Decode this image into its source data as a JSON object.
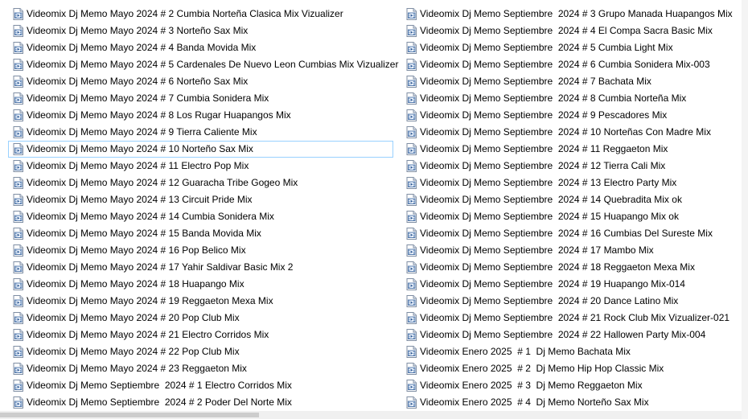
{
  "file_icon": "video-file-icon",
  "colors": {
    "focus_border": "#99d1ff",
    "icon_frame": "#5a7fb0",
    "icon_fill": "#e8f0fb"
  },
  "left_column": [
    "Videomix Dj Memo Mayo 2024 # 2 Cumbia Norteña Clasica Mix Vizualizer",
    "Videomix Dj Memo Mayo 2024 # 3 Norteño Sax Mix",
    "Videomix Dj Memo Mayo 2024 # 4 Banda Movida Mix",
    "Videomix Dj Memo Mayo 2024 # 5 Cardenales De Nuevo Leon Cumbias Mix Vizualizer",
    "Videomix Dj Memo Mayo 2024 # 6 Norteño Sax Mix",
    "Videomix Dj Memo Mayo 2024 # 7 Cumbia Sonidera Mix",
    "Videomix Dj Memo Mayo 2024 # 8 Los Rugar Huapangos Mix",
    "Videomix Dj Memo Mayo 2024 # 9 Tierra Caliente Mix",
    "Videomix Dj Memo Mayo 2024 # 10 Norteño Sax Mix",
    "Videomix Dj Memo Mayo 2024 # 11 Electro Pop Mix",
    "Videomix Dj Memo Mayo 2024 # 12 Guaracha Tribe Gogeo Mix",
    "Videomix Dj Memo Mayo 2024 # 13 Circuit Pride Mix",
    "Videomix Dj Memo Mayo 2024 # 14 Cumbia Sonidera Mix",
    "Videomix Dj Memo Mayo 2024 # 15 Banda Movida Mix",
    "Videomix Dj Memo Mayo 2024 # 16 Pop Belico Mix",
    "Videomix Dj Memo Mayo 2024 # 17 Yahir Saldivar Basic Mix 2",
    "Videomix Dj Memo Mayo 2024 # 18 Huapango Mix",
    "Videomix Dj Memo Mayo 2024 # 19 Reggaeton Mexa Mix",
    "Videomix Dj Memo Mayo 2024 # 20 Pop Club Mix",
    "Videomix Dj Memo Mayo 2024 # 21 Electro Corridos Mix",
    "Videomix Dj Memo Mayo 2024 # 22 Pop Club Mix",
    "Videomix Dj Memo Mayo 2024 # 23 Reggaeton Mix",
    "Videomix Dj Memo Septiembre  2024 # 1 Electro Corridos Mix",
    "Videomix Dj Memo Septiembre  2024 # 2 Poder Del Norte Mix"
  ],
  "right_column": [
    "Videomix Dj Memo Septiembre  2024 # 3 Grupo Manada Huapangos Mix",
    "Videomix Dj Memo Septiembre  2024 # 4 El Compa Sacra Basic Mix",
    "Videomix Dj Memo Septiembre  2024 # 5 Cumbia Light Mix",
    "Videomix Dj Memo Septiembre  2024 # 6 Cumbia Sonidera Mix-003",
    "Videomix Dj Memo Septiembre  2024 # 7 Bachata Mix",
    "Videomix Dj Memo Septiembre  2024 # 8 Cumbia Norteña Mix",
    "Videomix Dj Memo Septiembre  2024 # 9 Pescadores Mix",
    "Videomix Dj Memo Septiembre  2024 # 10 Norteñas Con Madre Mix",
    "Videomix Dj Memo Septiembre  2024 # 11 Reggaeton Mix",
    "Videomix Dj Memo Septiembre  2024 # 12 Tierra Cali Mix",
    "Videomix Dj Memo Septiembre  2024 # 13 Electro Party Mix",
    "Videomix Dj Memo Septiembre  2024 # 14 Quebradita Mix ok",
    "Videomix Dj Memo Septiembre  2024 # 15 Huapango Mix ok",
    "Videomix Dj Memo Septiembre  2024 # 16 Cumbias Del Sureste Mix",
    "Videomix Dj Memo Septiembre  2024 # 17 Mambo Mix",
    "Videomix Dj Memo Septiembre  2024 # 18 Reggaeton Mexa Mix",
    "Videomix Dj Memo Septiembre  2024 # 19 Huapango Mix-014",
    "Videomix Dj Memo Septiembre  2024 # 20 Dance Latino Mix",
    "Videomix Dj Memo Septiembre  2024 # 21 Rock Club Mix Vizualizer-021",
    "Videomix Dj Memo Septiembre  2024 # 22 Hallowen Party Mix-004",
    "Videomix Enero 2025  # 1  Dj Memo Bachata Mix",
    "Videomix Enero 2025  # 2  Dj Memo Hip Hop Classic Mix",
    "Videomix Enero 2025  # 3  Dj Memo Reggaeton Mix",
    "Videomix Enero 2025  # 4  Dj Memo Norteño Sax Mix"
  ]
}
